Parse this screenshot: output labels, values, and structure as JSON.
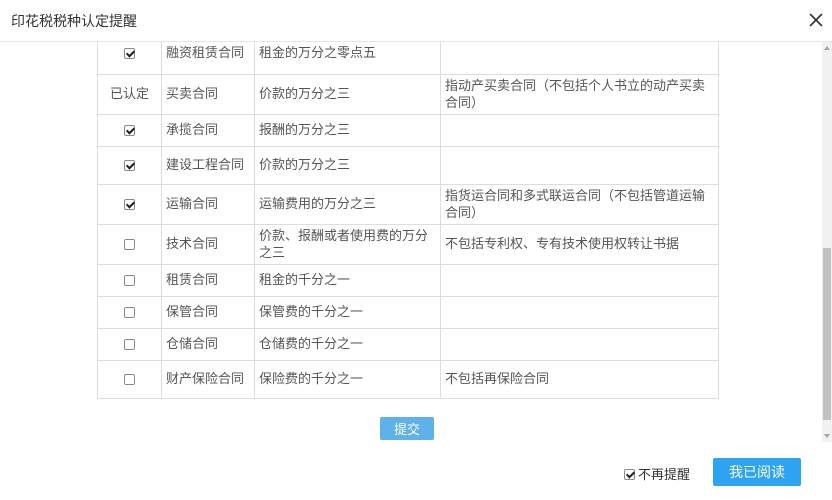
{
  "dialog": {
    "title": "印花税税种认定提醒",
    "submit_label": "提交",
    "dont_remind_label": "不再提醒",
    "dont_remind_checked": true,
    "read_label": "我已阅读"
  },
  "table": {
    "rows": [
      {
        "status": "checkbox",
        "checked": true,
        "name": "融资租赁合同",
        "rate": "租金的万分之零点五",
        "note": ""
      },
      {
        "status": "已认定",
        "checked": false,
        "name": "买卖合同",
        "rate": "价款的万分之三",
        "note": "指动产买卖合同（不包括个人书立的动产买卖合同）"
      },
      {
        "status": "checkbox",
        "checked": true,
        "name": "承揽合同",
        "rate": "报酬的万分之三",
        "note": ""
      },
      {
        "status": "checkbox",
        "checked": true,
        "name": "建设工程合同",
        "rate": "价款的万分之三",
        "note": ""
      },
      {
        "status": "checkbox",
        "checked": true,
        "name": "运输合同",
        "rate": "运输费用的万分之三",
        "note": "指货运合同和多式联运合同（不包括管道运输合同）"
      },
      {
        "status": "checkbox",
        "checked": false,
        "name": "技术合同",
        "rate": "价款、报酬或者使用费的万分之三",
        "note": "不包括专利权、专有技术使用权转让书据"
      },
      {
        "status": "checkbox",
        "checked": false,
        "name": "租赁合同",
        "rate": "租金的千分之一",
        "note": ""
      },
      {
        "status": "checkbox",
        "checked": false,
        "name": "保管合同",
        "rate": "保管费的千分之一",
        "note": ""
      },
      {
        "status": "checkbox",
        "checked": false,
        "name": "仓储合同",
        "rate": "仓储费的千分之一",
        "note": ""
      },
      {
        "status": "checkbox",
        "checked": false,
        "name": "财产保险合同",
        "rate": "保险费的千分之一",
        "note": "不包括再保险合同"
      }
    ]
  }
}
